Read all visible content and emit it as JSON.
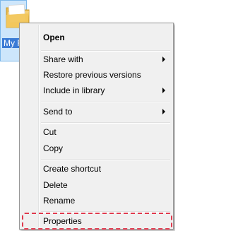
{
  "desktop": {
    "folder": {
      "label": "My F",
      "icon": "folder-icon"
    }
  },
  "context_menu": {
    "items": [
      {
        "label": "Open",
        "bold": true,
        "submenu": false
      },
      {
        "label": "Share with",
        "bold": false,
        "submenu": true
      },
      {
        "label": "Restore previous versions",
        "bold": false,
        "submenu": false
      },
      {
        "label": "Include in library",
        "bold": false,
        "submenu": true
      },
      {
        "label": "Send to",
        "bold": false,
        "submenu": true
      },
      {
        "label": "Cut",
        "bold": false,
        "submenu": false
      },
      {
        "label": "Copy",
        "bold": false,
        "submenu": false
      },
      {
        "label": "Create shortcut",
        "bold": false,
        "submenu": false
      },
      {
        "label": "Delete",
        "bold": false,
        "submenu": false
      },
      {
        "label": "Rename",
        "bold": false,
        "submenu": false
      },
      {
        "label": "Properties",
        "bold": false,
        "submenu": false,
        "highlighted": true
      }
    ],
    "highlight_color": "#e03a4e"
  }
}
